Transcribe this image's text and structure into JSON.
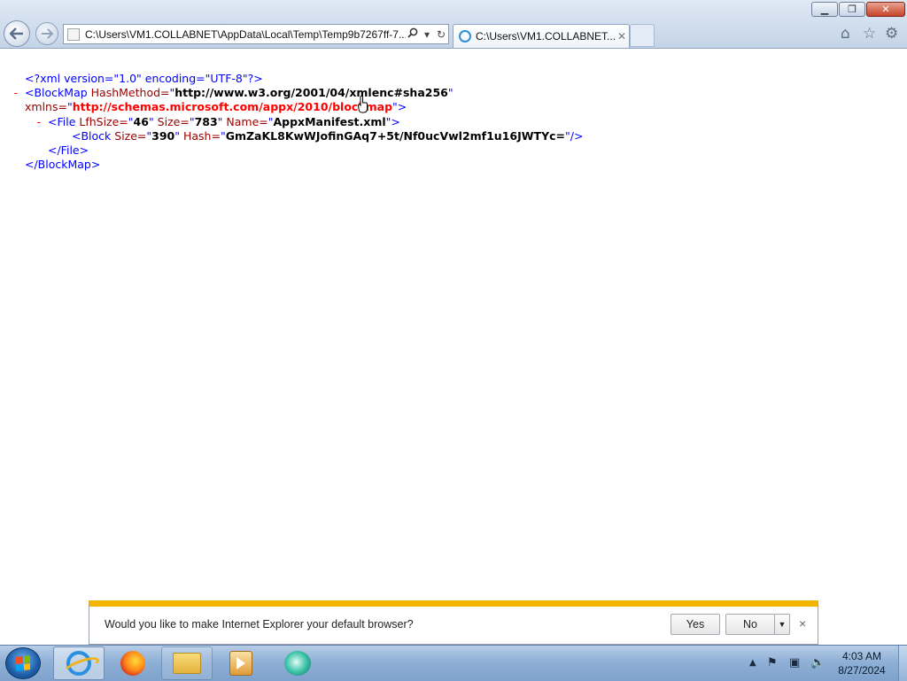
{
  "window": {
    "minimize_label": "▁",
    "restore_label": "❐",
    "close_label": "✕"
  },
  "toolbar": {
    "address_value": "C:\\Users\\VM1.COLLABNET\\AppData\\Local\\Temp\\Temp9b7267ff-7...",
    "tab_title": "C:\\Users\\VM1.COLLABNET...",
    "icons": [
      "back-icon",
      "forward-icon",
      "search-icon",
      "refresh-icon",
      "home-icon",
      "favorites-icon",
      "tools-icon"
    ]
  },
  "xml": {
    "decl_open": "<?xml ",
    "decl_version_attr": "version=",
    "decl_version_val": "\"1.0\"",
    "decl_encoding_attr": " encoding=",
    "decl_encoding_val": "\"UTF-8\"",
    "decl_close": "?>",
    "collapse_marker": "-",
    "blockmap_open": "<BlockMap",
    "hashmethod_attr": " HashMethod=",
    "hashmethod_val": "http://www.w3.org/2001/04/xmlenc#sha256",
    "xmlns_attr": "xmlns=",
    "xmlns_val": "http://schemas.microsoft.com/appx/2010/blockmap",
    "quote": "\"",
    "tag_end": ">",
    "file_open": "<File",
    "lfhsize_attr": " LfhSize=",
    "lfhsize_val": "46",
    "size_attr": " Size=",
    "size_val": "783",
    "name_attr": " Name=",
    "name_val": "AppxManifest.xml",
    "block_open": "<Block",
    "block_size_attr": " Size=",
    "block_size_val": "390",
    "hash_attr": " Hash=",
    "hash_val": "GmZaKL8KwWJofinGAq7+5t/Nf0ucVwl2mf1u16JWTYc=",
    "self_close": "/>",
    "file_close": "</File>",
    "blockmap_close": "</BlockMap>"
  },
  "notification": {
    "message": "Would you like to make Internet Explorer your default browser?",
    "yes_label": "Yes",
    "no_label": "No",
    "dropdown_label": "▼",
    "close_label": "×"
  },
  "taskbar": {
    "apps": [
      "Internet Explorer",
      "Firefox",
      "Windows Explorer",
      "Media Player",
      "App"
    ],
    "clock_time": "4:03 AM",
    "clock_date": "8/27/2024"
  }
}
